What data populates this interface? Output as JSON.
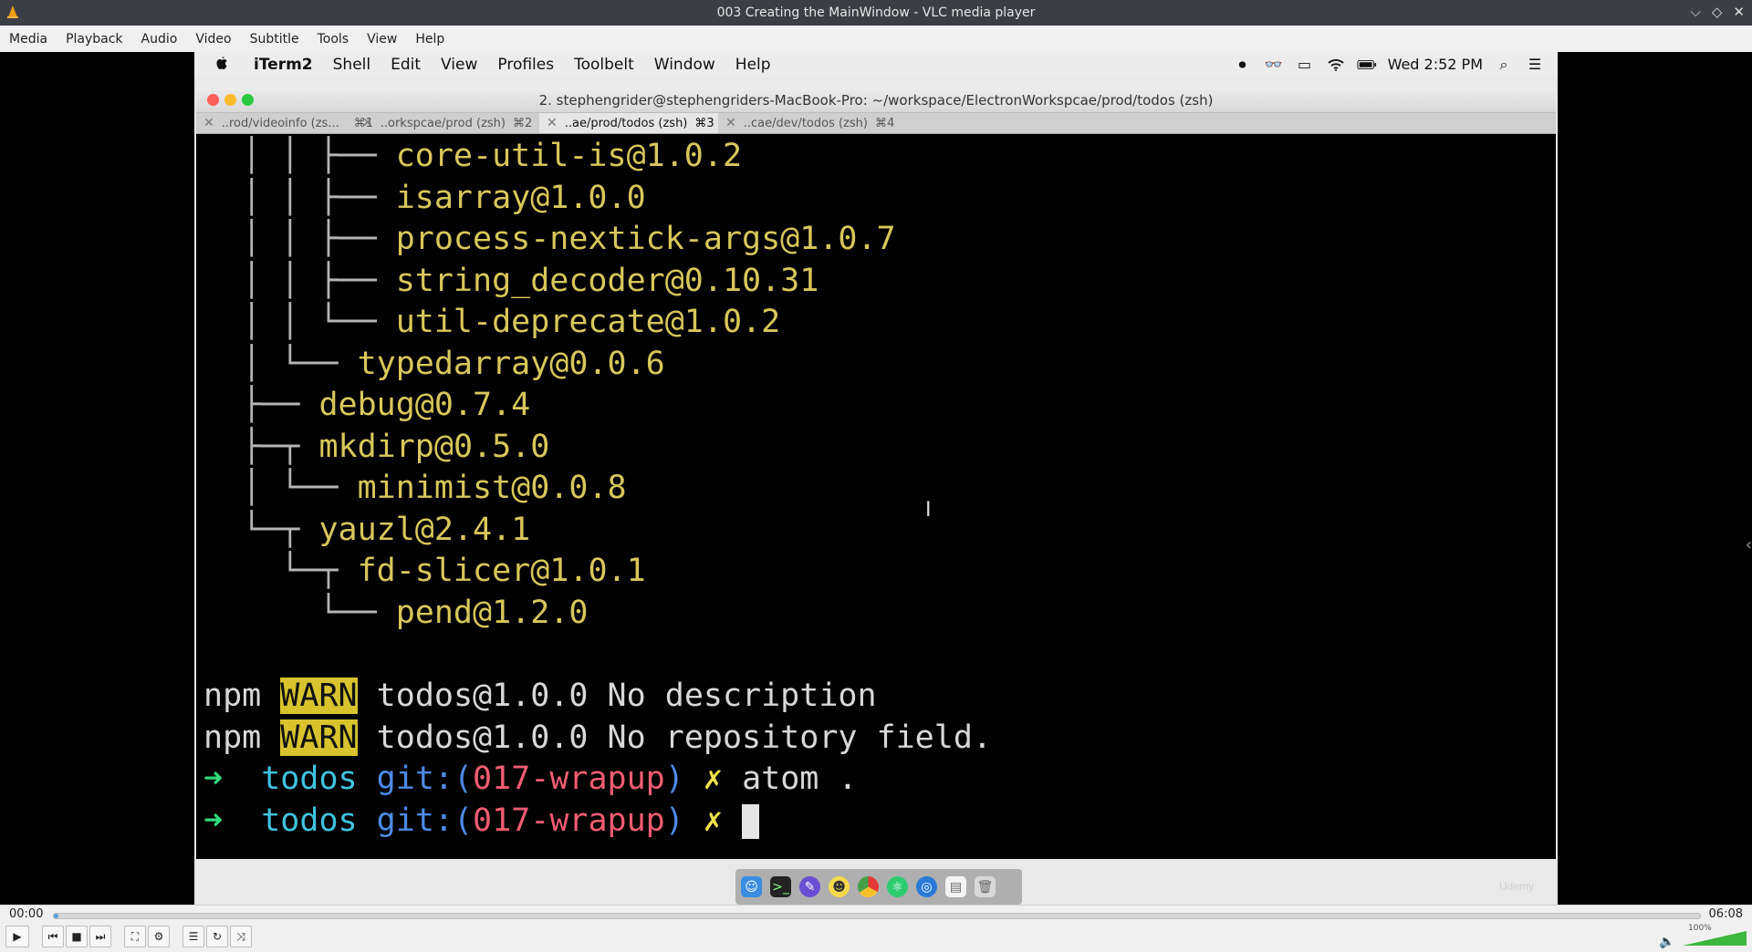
{
  "vlc": {
    "title": "003 Creating the MainWindow - VLC media player",
    "menu": [
      "Media",
      "Playback",
      "Audio",
      "Video",
      "Subtitle",
      "Tools",
      "View",
      "Help"
    ],
    "time_current": "00:00",
    "time_total": "06:08",
    "progress_fraction": 0.003,
    "volume_label": "100%",
    "volume_fraction": 1.0
  },
  "mac": {
    "menubar": {
      "app": "iTerm2",
      "items": [
        "Shell",
        "Edit",
        "View",
        "Profiles",
        "Toolbelt",
        "Window",
        "Help"
      ]
    },
    "clock": "Wed 2:52 PM"
  },
  "iterm": {
    "window_title": "2. stephengrider@stephengriders-MacBook-Pro: ~/workspace/ElectronWorkspcae/prod/todos (zsh)",
    "tabs": [
      {
        "label": "..rod/videoinfo (zs...",
        "shortcut": "⌘1"
      },
      {
        "label": "..orkspcae/prod (zsh)",
        "shortcut": "⌘2"
      },
      {
        "label": "..ae/prod/todos (zsh)",
        "shortcut": "⌘3"
      },
      {
        "label": "..cae/dev/todos (zsh)",
        "shortcut": "⌘4"
      }
    ]
  },
  "terminal": {
    "tree": [
      {
        "prefix": "  │ │ ├── ",
        "pkg": "core-util-is@1.0.2"
      },
      {
        "prefix": "  │ │ ├── ",
        "pkg": "isarray@1.0.0"
      },
      {
        "prefix": "  │ │ ├── ",
        "pkg": "process-nextick-args@1.0.7"
      },
      {
        "prefix": "  │ │ ├── ",
        "pkg": "string_decoder@0.10.31"
      },
      {
        "prefix": "  │ │ └── ",
        "pkg": "util-deprecate@1.0.2"
      },
      {
        "prefix": "  │ └── ",
        "pkg": "typedarray@0.0.6"
      },
      {
        "prefix": "  ├── ",
        "pkg": "debug@0.7.4"
      },
      {
        "prefix": "  ├─┬ ",
        "pkg": "mkdirp@0.5.0"
      },
      {
        "prefix": "  │ └── ",
        "pkg": "minimist@0.0.8"
      },
      {
        "prefix": "  └─┬ ",
        "pkg": "yauzl@2.4.1"
      },
      {
        "prefix": "    └─┬ ",
        "pkg": "fd-slicer@1.0.1"
      },
      {
        "prefix": "      └── ",
        "pkg": "pend@1.2.0"
      }
    ],
    "warn1": {
      "npm": "npm",
      "warn": "WARN",
      "msg": "todos@1.0.0 No description"
    },
    "warn2": {
      "npm": "npm",
      "warn": "WARN",
      "msg": "todos@1.0.0 No repository field."
    },
    "prompt1": {
      "arrow": "➜",
      "cwd": "todos",
      "git_open": "git:(",
      "branch": "017-wrapup",
      "git_close": ")",
      "x": "✗",
      "cmd": "atom ."
    },
    "prompt2": {
      "arrow": "➜",
      "cwd": "todos",
      "git_open": "git:(",
      "branch": "017-wrapup",
      "git_close": ")",
      "x": "✗"
    }
  },
  "watermark": "Udemy"
}
